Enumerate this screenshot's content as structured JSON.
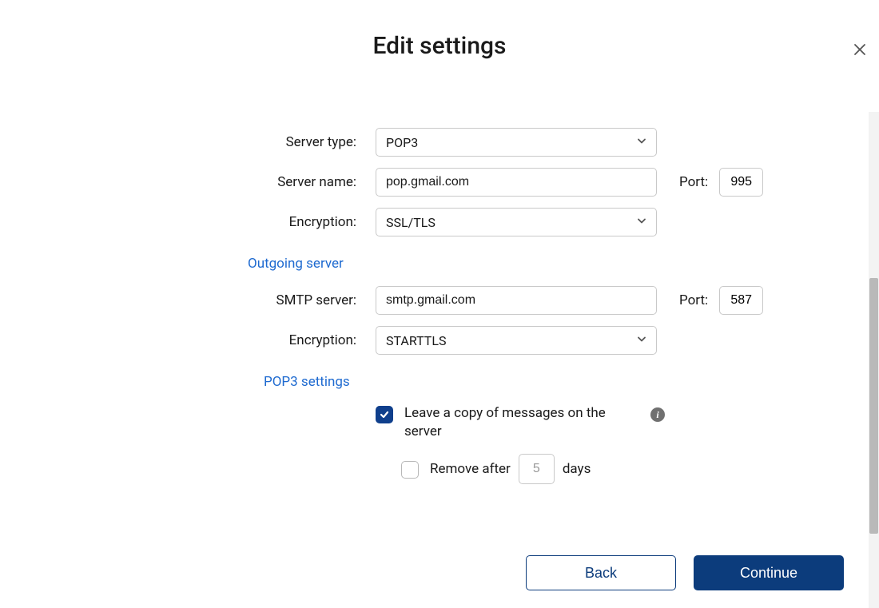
{
  "title": "Edit settings",
  "incoming": {
    "server_type_label": "Server type:",
    "server_type_value": "POP3",
    "server_name_label": "Server name:",
    "server_name_value": "pop.gmail.com",
    "port_label": "Port:",
    "port_value": "995",
    "encryption_label": "Encryption:",
    "encryption_value": "SSL/TLS"
  },
  "outgoing": {
    "section_title": "Outgoing server",
    "smtp_label": "SMTP server:",
    "smtp_value": "smtp.gmail.com",
    "port_label": "Port:",
    "port_value": "587",
    "encryption_label": "Encryption:",
    "encryption_value": "STARTTLS"
  },
  "pop3": {
    "section_title": "POP3 settings",
    "leave_copy_checked": true,
    "leave_copy_label": "Leave a copy of messages on the server",
    "remove_after_checked": false,
    "remove_after_label": "Remove after",
    "remove_after_days_placeholder": "5",
    "remove_after_suffix": "days"
  },
  "footer": {
    "back": "Back",
    "continue": "Continue"
  }
}
